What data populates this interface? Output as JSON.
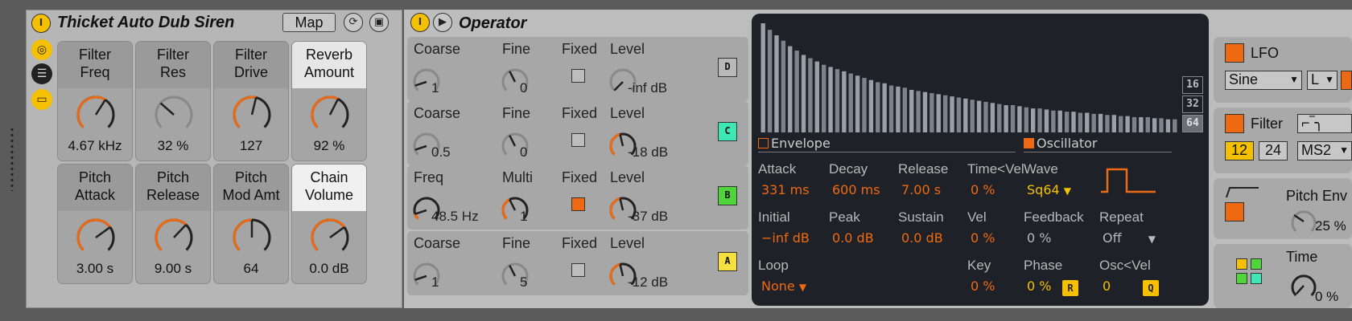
{
  "rack": {
    "title": "Thicket Auto Dub Siren",
    "power_label": "I",
    "map_label": "Map",
    "macros": [
      {
        "name": "Filter\nFreq",
        "value": "4.67 kHz",
        "amount": 0.62
      },
      {
        "name": "Filter\nRes",
        "value": "32 %",
        "amount": 0.32
      },
      {
        "name": "Filter\nDrive",
        "value": "127",
        "amount": 0.55
      },
      {
        "name": "Reverb\nAmount",
        "value": "92 %",
        "amount": 0.6
      },
      {
        "name": "Pitch\nAttack",
        "value": "3.00 s",
        "amount": 0.7
      },
      {
        "name": "Pitch\nRelease",
        "value": "9.00 s",
        "amount": 0.66
      },
      {
        "name": "Pitch\nMod Amt",
        "value": "64",
        "amount": 0.5
      },
      {
        "name": "Chain\nVolume",
        "value": "0.0 dB",
        "amount": 0.7
      }
    ]
  },
  "operator": {
    "title": "Operator",
    "power_label": "I",
    "oscillators": [
      {
        "l1": "Coarse",
        "v1": "1",
        "l2": "Fine",
        "v2": "0",
        "l3": "Fixed",
        "fixed": false,
        "l4": "Level",
        "v4": "-inf dB",
        "btn": "D",
        "btn_color": "#b8b8b8"
      },
      {
        "l1": "Coarse",
        "v1": "0.5",
        "l2": "Fine",
        "v2": "0",
        "l3": "Fixed",
        "fixed": false,
        "l4": "Level",
        "v4": "-18 dB",
        "btn": "C",
        "btn_color": "#3de8b4"
      },
      {
        "l1": "Freq",
        "v1": "48.5 Hz",
        "l2": "Multi",
        "v2": "1",
        "l3": "Fixed",
        "fixed": true,
        "l4": "Level",
        "v4": "-37 dB",
        "btn": "B",
        "btn_color": "#4fd43a"
      },
      {
        "l1": "Coarse",
        "v1": "1",
        "l2": "Fine",
        "v2": "5",
        "l3": "Fixed",
        "fixed": false,
        "l4": "Level",
        "v4": "-12 dB",
        "btn": "A",
        "btn_color": "#f5e040"
      }
    ],
    "harmonics": {
      "values": [
        1.0,
        0.94,
        0.89,
        0.84,
        0.79,
        0.75,
        0.71,
        0.68,
        0.65,
        0.62,
        0.6,
        0.58,
        0.56,
        0.54,
        0.52,
        0.5,
        0.48,
        0.46,
        0.45,
        0.43,
        0.42,
        0.41,
        0.39,
        0.38,
        0.37,
        0.36,
        0.35,
        0.34,
        0.33,
        0.32,
        0.31,
        0.3,
        0.29,
        0.28,
        0.27,
        0.26,
        0.25,
        0.25,
        0.24,
        0.23,
        0.22,
        0.22,
        0.21,
        0.2,
        0.2,
        0.19,
        0.19,
        0.18,
        0.18,
        0.17,
        0.17,
        0.16,
        0.16,
        0.15,
        0.15,
        0.14,
        0.14,
        0.14,
        0.13,
        0.13,
        0.12,
        0.12
      ],
      "buttons": [
        "16",
        "32",
        "64"
      ]
    },
    "envelope": {
      "label": "Envelope",
      "attack_l": "Attack",
      "attack": "331 ms",
      "decay_l": "Decay",
      "decay": "600 ms",
      "release_l": "Release",
      "release": "7.00 s",
      "tvel_l": "Time<Vel",
      "tvel": "0 %",
      "initial_l": "Initial",
      "initial": "−inf dB",
      "peak_l": "Peak",
      "peak": "0.0 dB",
      "sustain_l": "Sustain",
      "sustain": "0.0 dB",
      "vel_l": "Vel",
      "vel": "0 %",
      "loop_l": "Loop",
      "loop": "None",
      "key_l": "Key",
      "key": "0 %"
    },
    "oscillator": {
      "label": "Oscillator",
      "wave_l": "Wave",
      "wave": "Sq64",
      "feedback_l": "Feedback",
      "feedback": "0 %",
      "repeat_l": "Repeat",
      "repeat": "Off",
      "phase_l": "Phase",
      "phase": "0 %",
      "phase_btn": "R",
      "oscvel_l": "Osc<Vel",
      "oscvel": "0",
      "oscvel_btn": "Q"
    },
    "lfo": {
      "label": "LFO",
      "wave": "Sine",
      "range": "L"
    },
    "filter": {
      "label": "Filter",
      "slope_a": "12",
      "slope_b": "24",
      "type": "MS2"
    },
    "pitch_env": {
      "label": "Pitch Env",
      "value": "25 %"
    },
    "time": {
      "label": "Time",
      "value": "0 %"
    }
  },
  "colors": {
    "accent": "#ee6a12",
    "yellow": "#f5c000",
    "display_bg": "#1e2127"
  }
}
